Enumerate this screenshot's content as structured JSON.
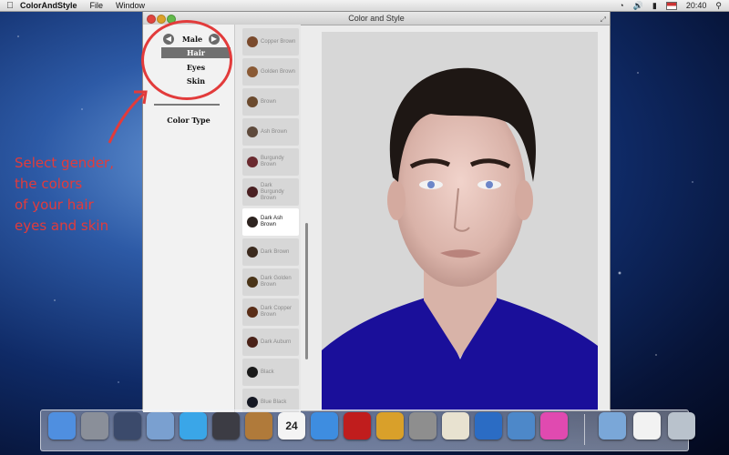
{
  "menubar": {
    "app_name": "ColorAndStyle",
    "items": [
      "File",
      "Window"
    ],
    "clock": "20:40"
  },
  "window": {
    "title": "Color and Style"
  },
  "panel": {
    "gender": "Male",
    "options": [
      "Hair",
      "Eyes",
      "Skin"
    ],
    "selected_option": "Hair",
    "color_type_label": "Color Type"
  },
  "swatches": [
    {
      "label": "Copper Brown",
      "color": "#7a4a2c"
    },
    {
      "label": "Golden Brown",
      "color": "#8a5a35"
    },
    {
      "label": "Brown",
      "color": "#6b4a2e"
    },
    {
      "label": "Ash Brown",
      "color": "#5e4a3c"
    },
    {
      "label": "Burgundy Brown",
      "color": "#6a2a2f"
    },
    {
      "label": "Dark Burgundy Brown",
      "color": "#4a2022"
    },
    {
      "label": "Dark Ash Brown",
      "color": "#2e2420",
      "selected": true
    },
    {
      "label": "Dark Brown",
      "color": "#3b2a1e"
    },
    {
      "label": "Dark Golden Brown",
      "color": "#4a3418"
    },
    {
      "label": "Dark Copper Brown",
      "color": "#5a2e18"
    },
    {
      "label": "Dark Auburn",
      "color": "#4a2218"
    },
    {
      "label": "Black",
      "color": "#1a1a1a"
    },
    {
      "label": "Blue Black",
      "color": "#151823"
    }
  ],
  "annotation": {
    "lines": [
      "Select gender,",
      "the colors",
      "of your hair",
      "eyes and skin"
    ],
    "color": "#e23b3b"
  },
  "dock": {
    "calendar_day": "24",
    "items": [
      "finder-icon",
      "launchpad-icon",
      "mission-control-icon",
      "mail-stamp-icon",
      "safari-icon",
      "facetime-icon",
      "address-book-icon",
      "calendar-icon",
      "itunes-icon",
      "photo-booth-icon",
      "iphoto-icon",
      "system-preferences-icon",
      "textedit-icon",
      "word-icon",
      "xcode-icon",
      "colorandstyle-icon",
      "folder-icon",
      "document-icon",
      "trash-icon"
    ]
  }
}
